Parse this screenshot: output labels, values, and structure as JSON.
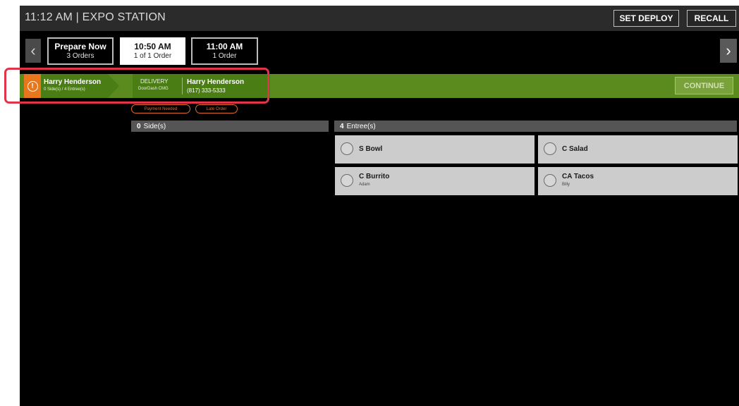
{
  "header": {
    "title": "11:12 AM | EXPO STATION",
    "set_deploy_label": "SET DEPLOY",
    "recall_label": "RECALL"
  },
  "nav": {
    "prev_glyph": "‹",
    "next_glyph": "›"
  },
  "time_tabs": [
    {
      "title": "Prepare Now",
      "subtitle": "3 Orders",
      "active": false
    },
    {
      "title": "10:50 AM",
      "subtitle": "1 of 1 Order",
      "active": true
    },
    {
      "title": "11:00 AM",
      "subtitle": "1 Order",
      "active": false
    }
  ],
  "order": {
    "alert_icon": "!",
    "customer_name": "Harry Henderson",
    "item_summary": "0 Side(s) / 4 Entree(s)",
    "order_type": "DELIVERY",
    "source": "DoorDash CMG",
    "contact_name": "Harry Henderson",
    "phone": "(817) 333-5333",
    "continue_label": "CONTINUE",
    "badges": [
      "Payment Needed",
      "Late Order"
    ]
  },
  "sides": {
    "count": "0",
    "label": "Side(s)"
  },
  "entrees": {
    "count": "4",
    "label": "Entree(s)",
    "items": [
      {
        "name": "S Bowl",
        "note": ""
      },
      {
        "name": "C Salad",
        "note": ""
      },
      {
        "name": "C Burrito",
        "note": "Adam"
      },
      {
        "name": "CA Tacos",
        "note": "Billy"
      }
    ]
  },
  "colors": {
    "order_strip": "#5b8a1f",
    "alert": "#e8761c",
    "badge": "#e06b2a",
    "highlight": "#e0344a"
  }
}
